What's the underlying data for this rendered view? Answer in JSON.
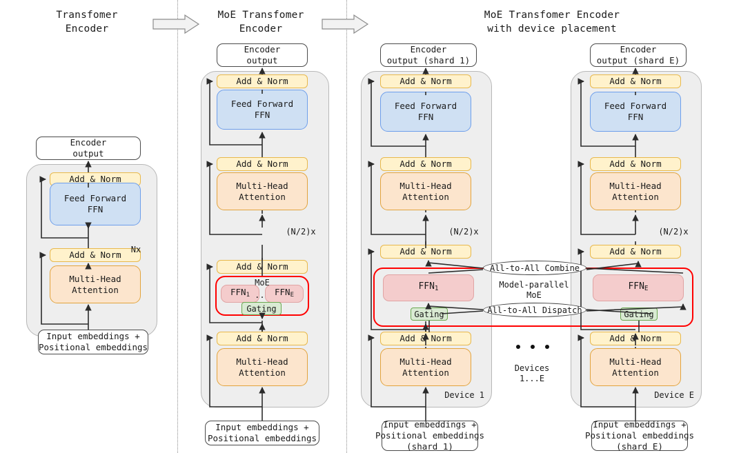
{
  "titles": {
    "col1": "Transfomer\nEncoder",
    "col2": "MoE Transfomer\nEncoder",
    "col3": "MoE Transfomer Encoder\nwith device placement"
  },
  "labels": {
    "encoder_output": "Encoder\noutput",
    "encoder_output_shard1": "Encoder\noutput (shard 1)",
    "encoder_output_shardE": "Encoder\noutput (shard E)",
    "add_norm": "Add & Norm",
    "feed_forward": "Feed Forward\nFFN",
    "multi_head": "Multi-Head\nAttention",
    "input_embeddings": "Input embeddings +\nPositional embeddings",
    "input_embeddings_shard1": "Input embeddings +\nPositional embeddings\n(shard 1)",
    "input_embeddings_shardE": "Input embeddings +\nPositional embeddings\n(shard E)",
    "nx": "Nx",
    "n_half_x": "(N/2)x",
    "moe": "MoE",
    "ffn_1": "FFN",
    "ffn_1_sub": "1",
    "ffn_E": "FFN",
    "ffn_E_sub": "E",
    "ellipsis": "...",
    "gating": "Gating",
    "all_to_all_combine": "All-to-All Combine",
    "all_to_all_dispatch": "All-to-All Dispatch",
    "model_parallel_moe": "Model-parallel\nMoE",
    "devices_range": "Devices\n1...E",
    "device_1": "Device 1",
    "device_E": "Device E"
  },
  "colors": {
    "add_norm_fill": "#fff2cc",
    "add_norm_stroke": "#e8b84b",
    "ffn_fill": "#cfe0f3",
    "ffn_stroke": "#6d9eeb",
    "attention_fill": "#fce5cd",
    "attention_stroke": "#e2a33c",
    "expert_fill": "#f4cccc",
    "expert_stroke": "#e0a3a3",
    "gating_fill": "#d9ead3",
    "gating_stroke": "#6aa84f",
    "shell_fill": "#eeeeee",
    "shell_stroke": "#b7b7b7",
    "moe_highlight": "#ff0000",
    "arrow": "#2b2b2b",
    "background": "#ffffff"
  },
  "flow_arrows": [
    {
      "name": "stage-arrow-1"
    },
    {
      "name": "stage-arrow-2"
    }
  ]
}
